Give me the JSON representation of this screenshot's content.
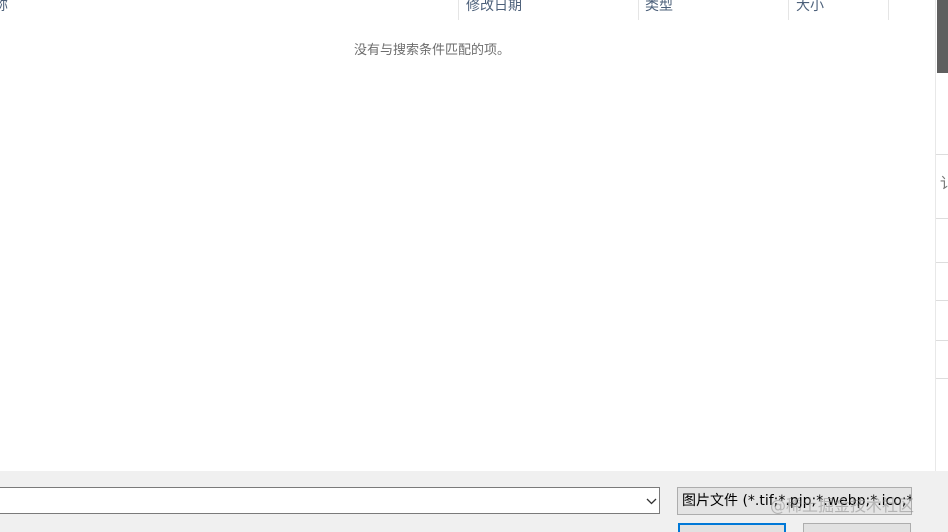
{
  "file_list": {
    "columns": [
      {
        "label": "称"
      },
      {
        "label": "修改日期"
      },
      {
        "label": "类型"
      },
      {
        "label": "大小"
      }
    ],
    "empty_message": "没有与搜索条件匹配的项。"
  },
  "side_panel": {
    "glyph": "讠"
  },
  "bottom": {
    "filename_value": "",
    "filetype_selected": "图片文件 (*.tif;*.pjp;*.webp;*.ico;*.",
    "watermark": "@稀土掘金技术社区"
  },
  "icons": {
    "dropdown": "chevron-down-icon"
  },
  "colors": {
    "header_text": "#4c607a",
    "bottom_bg": "#f0f0f0",
    "primary_button_border": "#0078d7"
  }
}
